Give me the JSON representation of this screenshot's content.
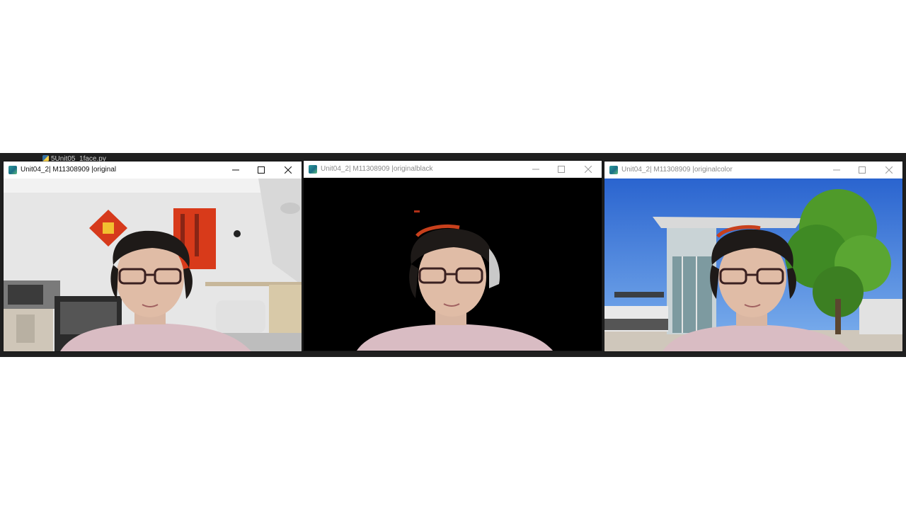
{
  "taskbar": {
    "file_tab": "5Unit05_1face.py"
  },
  "windows": [
    {
      "title": "Unit04_2| M11308909 |original",
      "state": "active",
      "background": "room"
    },
    {
      "title": "Unit04_2| M11308909 |originalblack",
      "state": "inactive",
      "background": "black"
    },
    {
      "title": "Unit04_2| M11308909 |originalcolor",
      "state": "inactive",
      "background": "building"
    }
  ],
  "controls": {
    "minimize_icon": "minimize-icon",
    "maximize_icon": "maximize-icon",
    "close_icon": "close-icon"
  },
  "colors": {
    "wall": "#e9e9e9",
    "sky": "#2f6fd6",
    "tree": "#3f8a24",
    "shirt": "#d8b8c0",
    "red_couplet": "#d83a1a"
  }
}
